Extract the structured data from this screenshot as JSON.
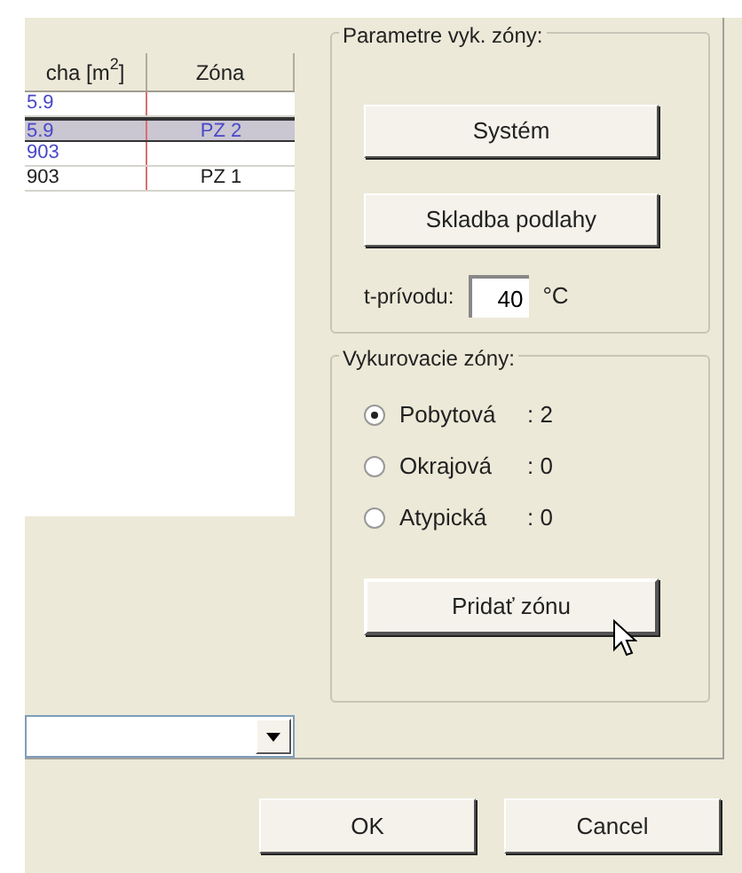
{
  "table": {
    "columns": [
      "cha [m$^{2}$]",
      "Zóna"
    ],
    "rows": [
      {
        "cells": [
          "5.9",
          ""
        ],
        "selected": false,
        "color": "#4848c8"
      },
      {
        "cells": [
          "5.9",
          "PZ 2"
        ],
        "selected": true,
        "color": "#4848c8"
      },
      {
        "cells": [
          "903",
          ""
        ],
        "selected": false,
        "color": "#4848c8"
      },
      {
        "cells": [
          "903",
          "PZ 1"
        ],
        "selected": false,
        "color": "#202020"
      }
    ]
  },
  "params_group": {
    "title": "Parametre vyk. zóny:",
    "buttons": [
      "Systém",
      "Skladba podlahy"
    ],
    "field_label": "t-prívodu:",
    "field_value": "40",
    "unit": "°C"
  },
  "zones_group": {
    "title": "Vykurovacie zóny:",
    "options": [
      {
        "label": "Pobytová",
        "count": ": 2",
        "selected": true
      },
      {
        "label": "Okrajová",
        "count": ": 0",
        "selected": false
      },
      {
        "label": "Atypická",
        "count": ": 0",
        "selected": false
      }
    ],
    "add_button": "Pridať zónu"
  },
  "footer_buttons": [
    "OK",
    "Cancel"
  ]
}
